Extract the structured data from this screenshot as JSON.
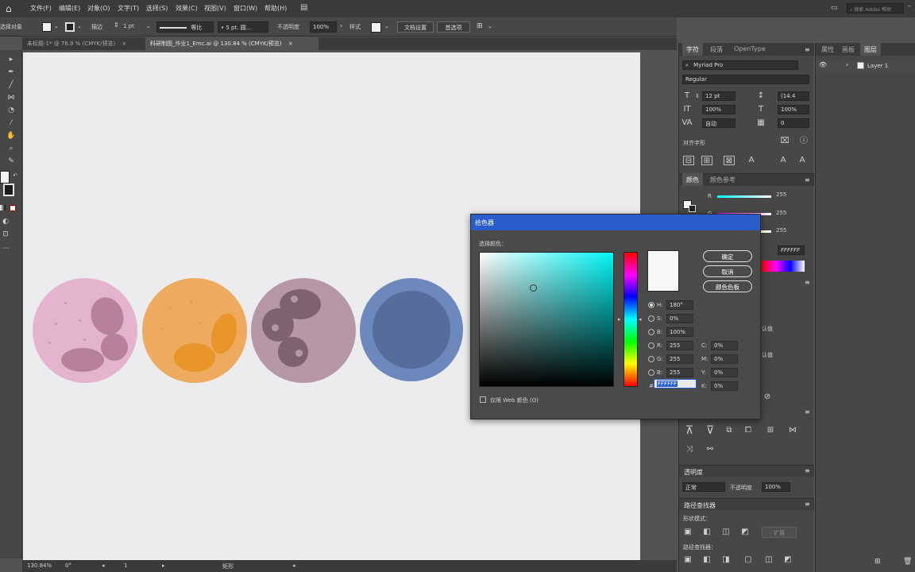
{
  "menubar": {
    "items": [
      "文件(F)",
      "编辑(E)",
      "对象(O)",
      "文字(T)",
      "选择(S)",
      "效果(C)",
      "视图(V)",
      "窗口(W)",
      "帮助(H)"
    ],
    "search_placeholder": "搜索 Adobe 帮助"
  },
  "controlbar": {
    "selection_label": "选择对象",
    "stroke_label": "描边",
    "stroke_value": "1 pt",
    "stroke_style": "等比",
    "brush_value": "5 pt. 圆...",
    "opacity_label": "不透明度",
    "opacity_value": "100%",
    "style_label": "样式",
    "doc_setup_button": "文档设置",
    "preferences_button": "首选项"
  },
  "doc_tabs": [
    {
      "label": "未标题-1* @ 76.9 % (CMYK/预览)",
      "active": false
    },
    {
      "label": "科研制图_作业1_Emc.ai @ 130.84 % (CMYK/预览)",
      "active": true
    }
  ],
  "status": {
    "zoom": "130.84%",
    "rotation": "0°",
    "artboard": "1",
    "tool_name": "矩形"
  },
  "character_panel": {
    "tabs": [
      "字符",
      "段落",
      "OpenType"
    ],
    "font_family": "Myriad Pro",
    "font_style": "Regular",
    "font_size": "12 pt",
    "leading": "(14.4",
    "vscale": "100%",
    "hscale": "100%",
    "kerning": "自动",
    "tracking": "0",
    "glyph_snap_label": "对齐字形"
  },
  "color_panel": {
    "tabs": [
      "颜色",
      "颜色参考"
    ],
    "r_label": "R",
    "g_label": "G",
    "b_label": "B",
    "r_value": "255",
    "g_value": "255",
    "b_value": "255",
    "hex": "FFFFFF",
    "default_label_1": "认值",
    "default_label_2": "认值"
  },
  "transparency_panel": {
    "title": "透明度",
    "mode": "正常",
    "opacity_label": "不透明度",
    "opacity_value": "100%"
  },
  "pathfinder_panel": {
    "title": "路径查找器",
    "shape_modes_label": "形状模式：",
    "pathfinders_label": "路径查找器：",
    "expand_button": "扩展"
  },
  "layers_panel": {
    "tabs": [
      "属性",
      "画板",
      "图层"
    ],
    "layer_name": "Layer 1"
  },
  "color_picker": {
    "title": "拾色器",
    "select_label": "选择颜色：",
    "ok_button": "确定",
    "cancel_button": "取消",
    "swatches_button": "颜色色板",
    "h_label": "H:",
    "s_label": "S:",
    "b_label": "B:",
    "r_label": "R:",
    "g_label": "G:",
    "bb_label": "B:",
    "h_value": "180°",
    "s_value": "0%",
    "b_value": "100%",
    "r_value": "255",
    "g_value": "255",
    "bb_value": "255",
    "c_label": "C:",
    "m_label": "M:",
    "y_label": "Y:",
    "k_label": "K:",
    "c_value": "0%",
    "m_value": "0%",
    "y_value": "0%",
    "k_value": "0%",
    "hex_label": "#",
    "hex_value": "FFFFFF",
    "web_only_label": "仅限 Web 颜色 (O)"
  },
  "colors": {
    "accent": "#2a5dc9",
    "cell_pink": "#e4b4cf",
    "cell_orange": "#eeaa5e",
    "cell_mauve": "#b597a7",
    "cell_blue": "#6d88bd"
  }
}
